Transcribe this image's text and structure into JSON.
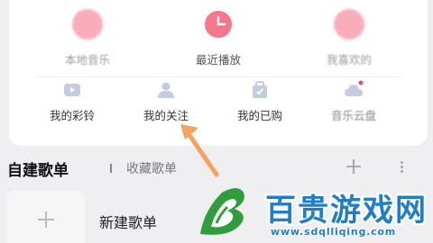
{
  "quick_access": [
    {
      "label": "本地音乐",
      "icon": "music-note-icon",
      "color": "#f24a66"
    },
    {
      "label": "最近播放",
      "icon": "clock-icon",
      "color": "#f24a66"
    },
    {
      "label": "我喜欢的",
      "icon": "heart-icon",
      "color": "#f24a66"
    }
  ],
  "shortcuts": [
    {
      "label": "我的彩铃",
      "icon": "ringtone-icon"
    },
    {
      "label": "我的关注",
      "icon": "person-icon"
    },
    {
      "label": "我的已购",
      "icon": "shopping-bag-icon"
    },
    {
      "label": "音乐云盘",
      "icon": "cloud-icon",
      "badge": true
    }
  ],
  "playlist_section": {
    "tab_active": "自建歌单",
    "tab_inactive": "收藏歌单",
    "new_playlist": "新建歌单"
  },
  "watermark": {
    "title": "百贵游戏网",
    "url": "www.sdqlliqing.com"
  },
  "colors": {
    "accent": "#f24a66",
    "icon_gray": "#b9c3d6",
    "arrow": "#f5a25d",
    "watermark_blue": "#1f7ec9"
  }
}
